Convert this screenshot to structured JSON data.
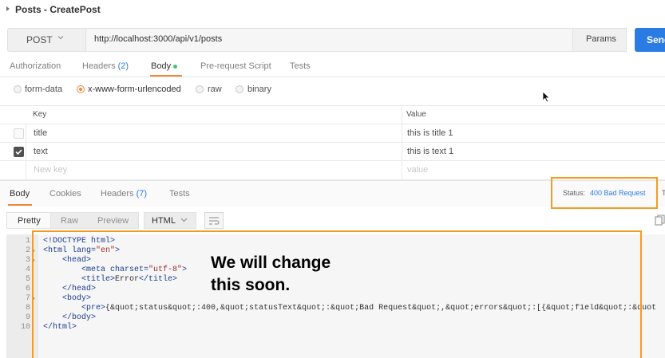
{
  "request": {
    "title": "Posts - CreatePost",
    "method": "POST",
    "url": "http://localhost:3000/api/v1/posts",
    "params_label": "Params",
    "send_label": "Send"
  },
  "request_tabs": {
    "authorization": "Authorization",
    "headers": "Headers",
    "headers_count": "(2)",
    "body": "Body",
    "prerequest": "Pre-request Script",
    "tests": "Tests"
  },
  "body_types": {
    "form_data": "form-data",
    "urlencoded": "x-www-form-urlencoded",
    "raw": "raw",
    "binary": "binary",
    "selected": "x-www-form-urlencoded"
  },
  "params_table": {
    "key_header": "Key",
    "value_header": "Value",
    "rows": [
      {
        "key": "title",
        "value": "this is title 1",
        "checked": false
      },
      {
        "key": "text",
        "value": "this is text 1",
        "checked": true
      }
    ],
    "new_key_placeholder": "New key",
    "new_value_placeholder": "value"
  },
  "response_tabs": {
    "body": "Body",
    "cookies": "Cookies",
    "headers": "Headers",
    "headers_count": "(7)",
    "tests": "Tests",
    "status_label": "Status:",
    "status_value": "400 Bad Request",
    "truncated": "T"
  },
  "view_bar": {
    "pretty": "Pretty",
    "raw": "Raw",
    "preview": "Preview",
    "format": "HTML"
  },
  "code": {
    "line_numbers": [
      "1",
      "2",
      "3",
      "4",
      "5",
      "6",
      "7",
      "8",
      "9",
      "10"
    ],
    "l1": "<!DOCTYPE html>",
    "l2_tag": "<html",
    "l2_attr": " lang=",
    "l2_val": "\"en\"",
    "l2_end": ">",
    "l3": "<head>",
    "l4_tag": "<meta",
    "l4_attr": " charset=",
    "l4_val": "\"utf-8\"",
    "l4_end": ">",
    "l5_open": "<title>",
    "l5_text": "Error",
    "l5_close": "</title>",
    "l6": "</head>",
    "l7": "<body>",
    "l8_open": "<pre>",
    "l8_text": "{&quot;status&quot;:400,&quot;statusText&quot;:&quot;Bad Request&quot;,&quot;errors&quot;:[{&quot;field&quot;:&quot",
    "l9": "</body>",
    "l10": "</html>"
  },
  "annotation": {
    "text": "We will change\nthis soon."
  },
  "colors": {
    "accent_orange": "#f0873a",
    "highlight_box": "#f39c22",
    "link_blue": "#2b7be5",
    "send_blue": "#2b7be5"
  }
}
